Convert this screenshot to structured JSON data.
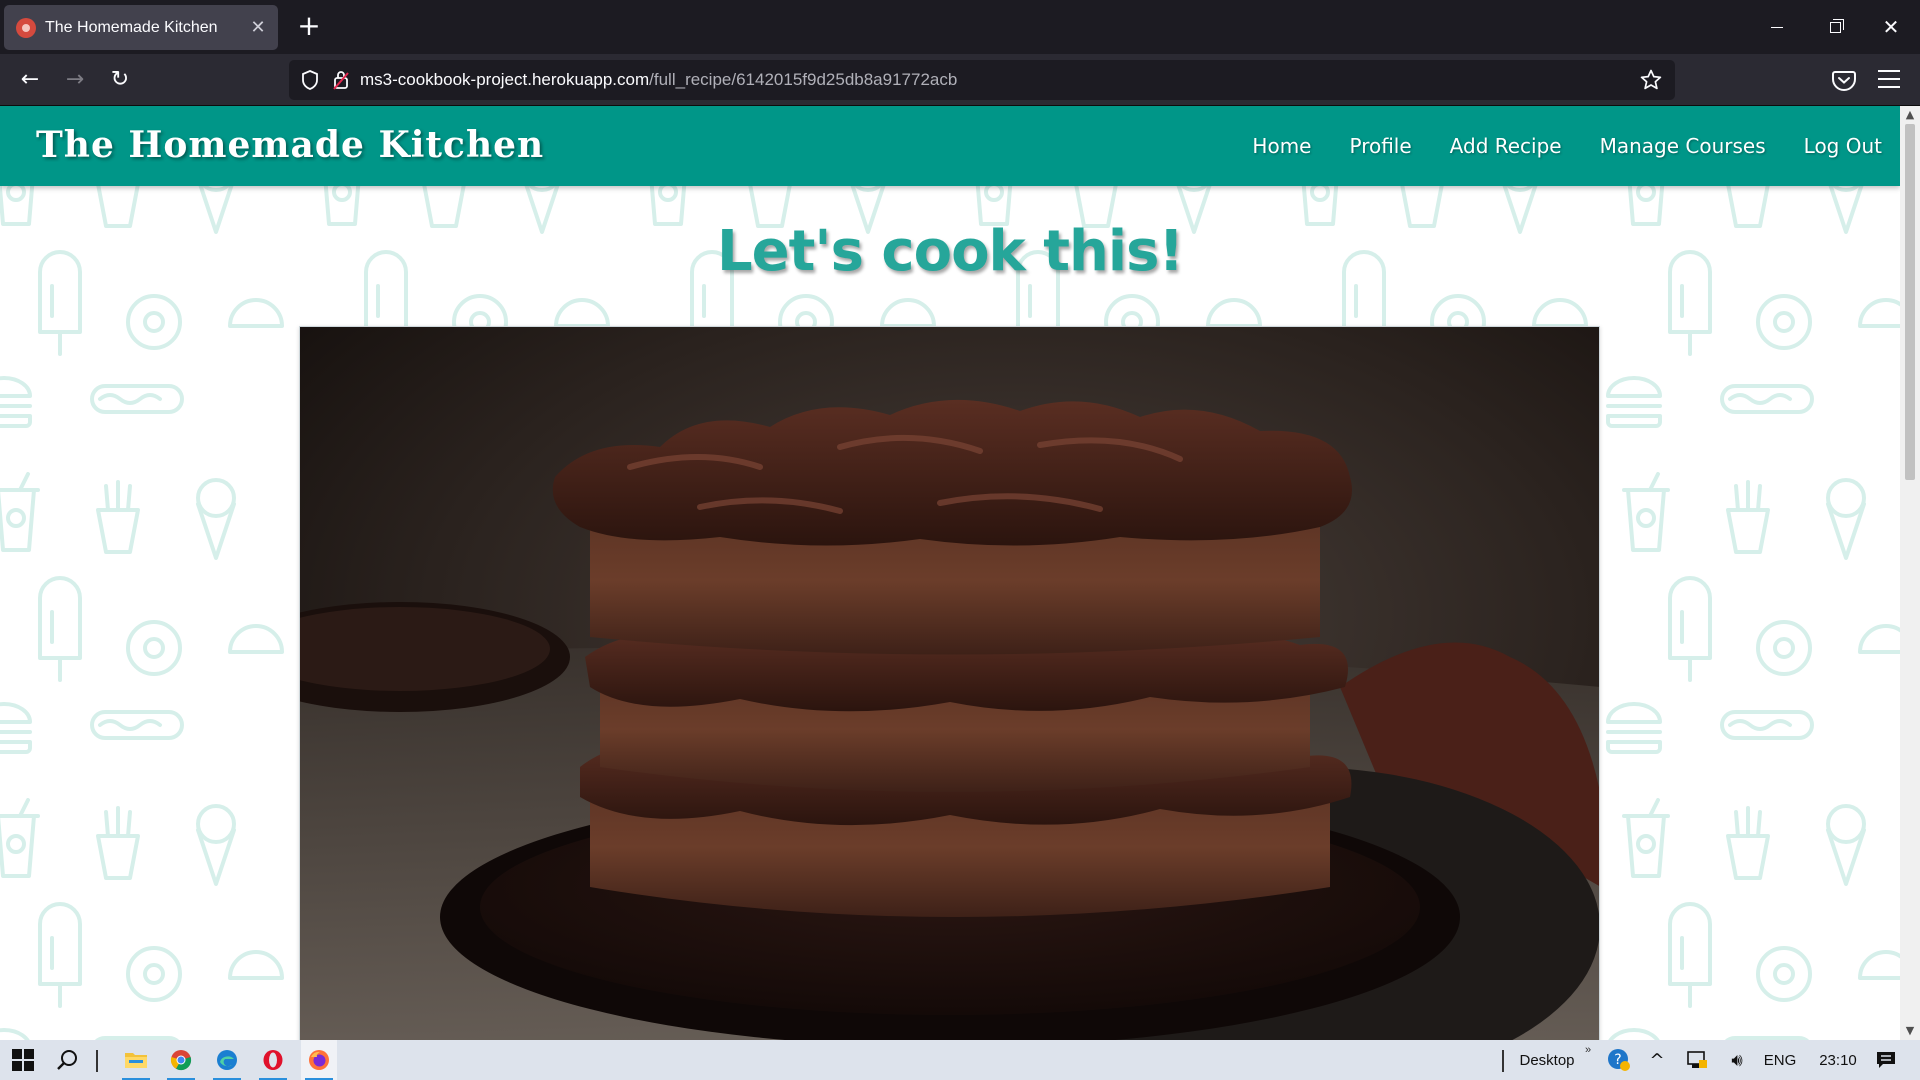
{
  "browser": {
    "tab_title": "The Homemade Kitchen",
    "tab_close": "✕",
    "new_tab": "+",
    "url_domain": "ms3-cookbook-project.herokuapp.com",
    "url_path": "/full_recipe/6142015f9d25db8a91772acb"
  },
  "site": {
    "brand": "The Homemade Kitchen",
    "nav": [
      "Home",
      "Profile",
      "Add Recipe",
      "Manage Courses",
      "Log Out"
    ],
    "heading": "Let's cook this!",
    "theme_color": "#009688",
    "heading_color": "#26a69a"
  },
  "taskbar": {
    "desktop_label": "Desktop",
    "language": "ENG",
    "time": "23:10"
  }
}
